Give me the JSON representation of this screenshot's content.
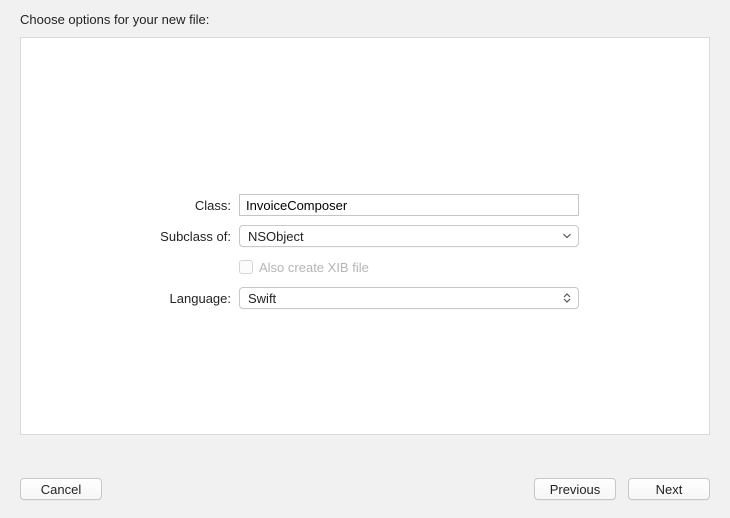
{
  "header": {
    "title": "Choose options for your new file:"
  },
  "form": {
    "class_label": "Class:",
    "class_value": "InvoiceComposer",
    "subclass_label": "Subclass of:",
    "subclass_value": "NSObject",
    "xib_label": "Also create XIB file",
    "language_label": "Language:",
    "language_value": "Swift"
  },
  "footer": {
    "cancel": "Cancel",
    "previous": "Previous",
    "next": "Next"
  }
}
